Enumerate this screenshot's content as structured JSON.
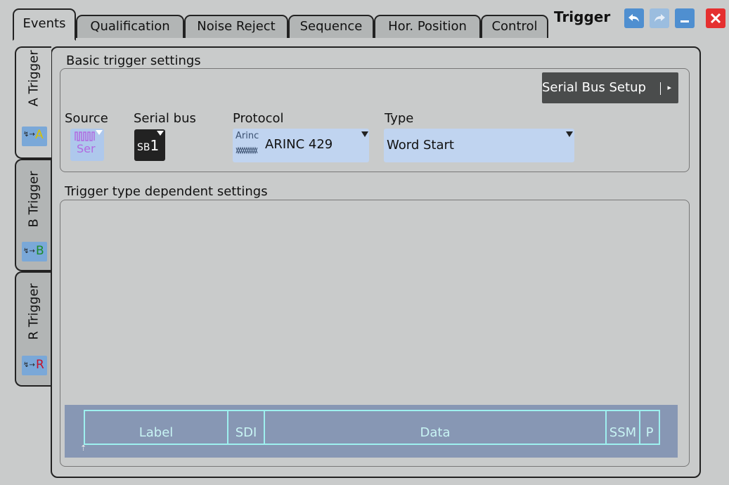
{
  "tabs": [
    {
      "label": "Events"
    },
    {
      "label": "Qualification"
    },
    {
      "label": "Noise Reject"
    },
    {
      "label": "Sequence"
    },
    {
      "label": "Hor. Position"
    },
    {
      "label": "Control"
    }
  ],
  "dialog_title": "Trigger",
  "side_tabs": [
    {
      "label": "A Trigger",
      "icon_letter": "A"
    },
    {
      "label": "B Trigger",
      "icon_letter": "B"
    },
    {
      "label": "R Trigger",
      "icon_letter": "R"
    }
  ],
  "basic": {
    "title": "Basic trigger settings",
    "serial_bus_button": "Serial Bus Setup",
    "source": {
      "label": "Source",
      "icon_text": "Ser"
    },
    "serial_bus": {
      "label": "Serial bus",
      "value_prefix": "SB",
      "value_num": "1"
    },
    "protocol": {
      "label": "Protocol",
      "icon_text": "Arinc",
      "value": "ARINC 429"
    },
    "type": {
      "label": "Type",
      "value": "Word Start"
    }
  },
  "dependent": {
    "title": "Trigger type dependent settings"
  },
  "frame_fields": [
    "Label",
    "SDI",
    "Data",
    "SSM",
    "P"
  ],
  "colors": {
    "accent_blue": "#c0d4f0",
    "close_red": "#e53030",
    "frame_bg": "#8797b4",
    "frame_outline": "#9ef0ef"
  }
}
